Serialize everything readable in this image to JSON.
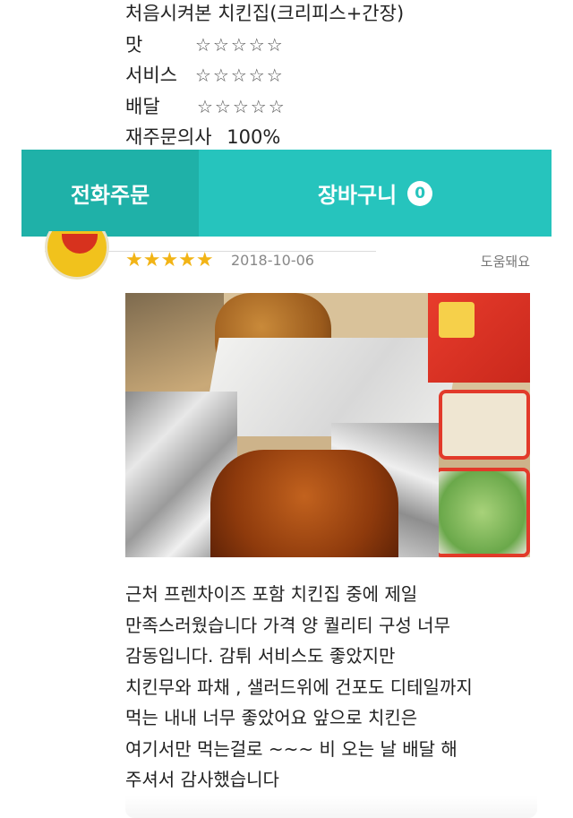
{
  "previous_review": {
    "title": "처음시켜본 치킨집(크리피스+간장)",
    "ratings": [
      {
        "label": "맛",
        "stars": "☆☆☆☆☆"
      },
      {
        "label": "서비스",
        "stars": "☆☆☆☆☆"
      },
      {
        "label": "배달",
        "stars": "☆☆☆☆☆"
      }
    ],
    "reorder_label": "재주문의사",
    "reorder_value": "100%"
  },
  "action_bar": {
    "phone_order_label": "전화주문",
    "cart_label": "장바구니",
    "cart_count": "0",
    "colors": {
      "phone": "#1fb1a8",
      "cart": "#26c4bd"
    }
  },
  "review": {
    "rating": 5,
    "stars": "★★★★★",
    "date": "2018-10-06",
    "helpful_label": "도움돼요",
    "photo_icon": "food-photo",
    "body_lines": [
      "근처 프렌차이즈 포함 치킨집 중에 제일",
      "만족스러웠습니다 가격 양 퀄리티 구성 너무",
      "감동입니다. 감튀 서비스도 좋았지만",
      "치킨무와 파채 , 샐러드위에 건포도 디테일까지",
      "먹는 내내 너무 좋았어요 앞으로 치킨은",
      "여기서만 먹는걸로 ~~~ 비 오는 날 배달 해",
      "주셔서 감사했습니다"
    ]
  }
}
